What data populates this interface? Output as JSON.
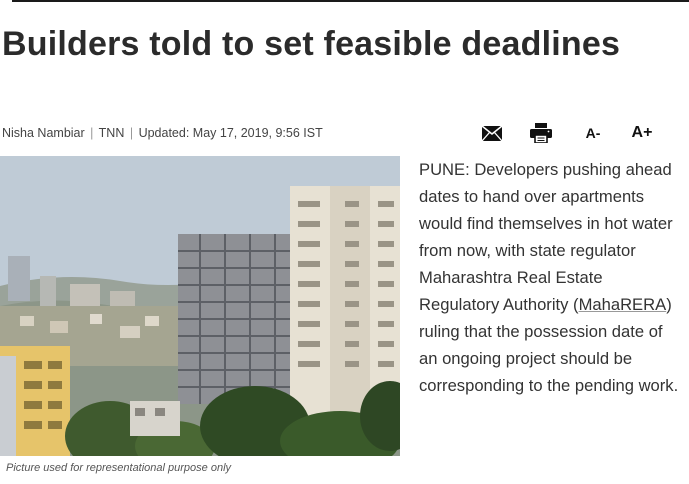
{
  "article": {
    "headline": "Builders told to set feasible deadlines",
    "byline": {
      "author": "Nisha Nambiar",
      "source": "TNN",
      "updated": "Updated: May 17, 2019, 9:56 IST"
    },
    "tools": {
      "font_decrease_label": "A-",
      "font_increase_label": "A+"
    },
    "image_caption": "Picture used for representational purpose only",
    "body": {
      "intro": "PUNE: Developers pushing ahead dates to hand over apartments would find themselves in hot water from now, with state regulator Maharashtra Real Estate Regulatory Authority (",
      "link_text": "MahaRERA",
      "outro": ") ruling that the possession date of an ongoing project should be corresponding to the pending work."
    }
  },
  "icons": {
    "mail": "mail-icon",
    "print": "print-icon"
  },
  "colors": {
    "headline": "#2b2b2b",
    "text": "#333333",
    "rule": "#1a1a1a"
  }
}
